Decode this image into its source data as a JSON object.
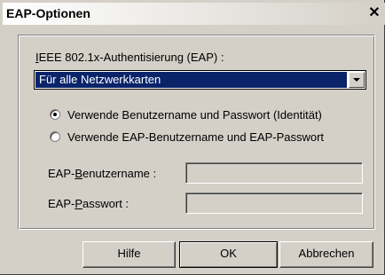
{
  "window": {
    "title": "EAP-Optionen",
    "close_glyph": "✕"
  },
  "eap": {
    "label_hotkey": "I",
    "label_rest": "EEE 802.1x-Authentisierung (EAP) :",
    "selected": "Für alle Netzwerkkarten"
  },
  "radios": [
    {
      "label": "Verwende Benutzername und Passwort (Identität)",
      "checked": true
    },
    {
      "label": "Verwende EAP-Benutzername und EAP-Passwort",
      "checked": false
    }
  ],
  "fields": {
    "username_prefix": "EAP-",
    "username_hotkey": "B",
    "username_rest": "enutzername :",
    "username_value": "",
    "password_prefix": "EAP-",
    "password_hotkey": "P",
    "password_rest": "asswort :",
    "password_value": ""
  },
  "buttons": {
    "help": "Hilfe",
    "ok": "OK",
    "cancel": "Abbrechen"
  }
}
